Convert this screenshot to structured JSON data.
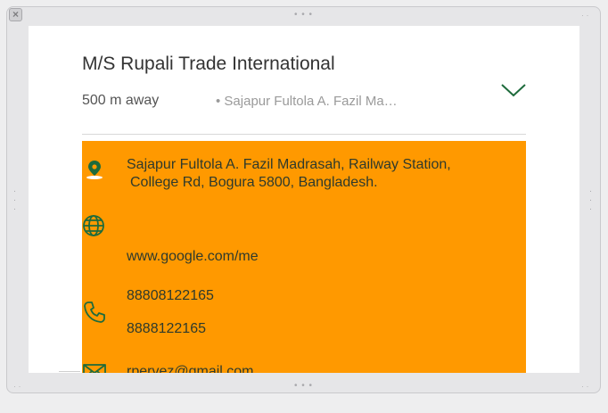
{
  "window": {
    "close_glyph": "×",
    "grip_glyph": "• • •",
    "corner_glyph": "· ·"
  },
  "place": {
    "name": "M/S Rupali Trade International",
    "distance": "500 m away",
    "short_address": "• Sajapur Fultola A. Fazil Ma…",
    "expand_icon": "chevron-down-icon"
  },
  "details": {
    "background_color": "#ff9900",
    "icon_color": "#1e6b3c",
    "address_line1": "Sajapur Fultola A. Fazil Madrasah, Railway Station,",
    "address_line2": "College Rd, Bogura 5800, Bangladesh.",
    "website": "www.google.com/me",
    "phone1": "88808122165",
    "phone2": "8888122165",
    "email": "rpervez@gmail.com",
    "icons": [
      "location-pin-icon",
      "globe-icon",
      "phone-icon",
      "mail-icon"
    ]
  }
}
